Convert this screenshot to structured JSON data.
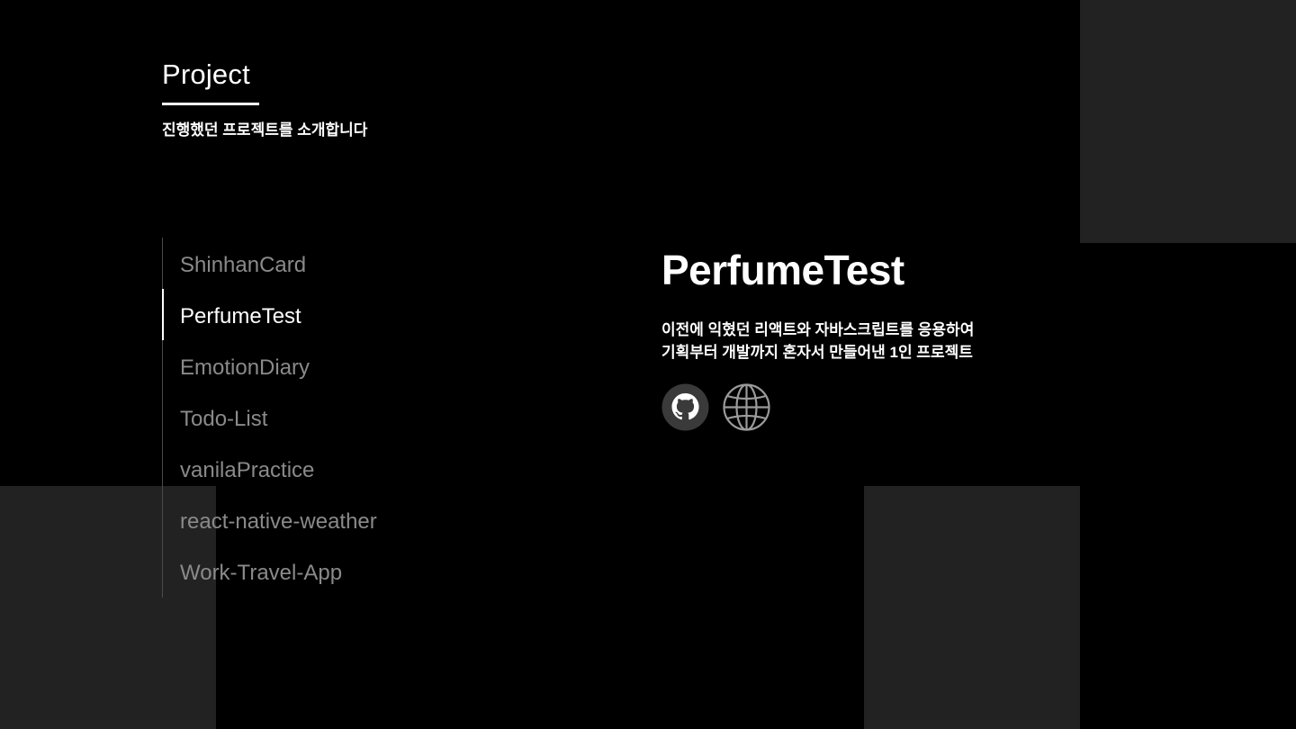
{
  "section": {
    "title": "Project",
    "subtitle": "진행했던 프로젝트를 소개합니다"
  },
  "projects": [
    {
      "label": "ShinhanCard",
      "active": false
    },
    {
      "label": "PerfumeTest",
      "active": true
    },
    {
      "label": "EmotionDiary",
      "active": false
    },
    {
      "label": "Todo-List",
      "active": false
    },
    {
      "label": "vanilaPractice",
      "active": false
    },
    {
      "label": "react-native-weather",
      "active": false
    },
    {
      "label": "Work-Travel-App",
      "active": false
    }
  ],
  "detail": {
    "title": "PerfumeTest",
    "description_line1": "이전에 익혔던 리액트와 자바스크립트를 응용하여",
    "description_line2": "기획부터 개발까지 혼자서 만들어낸 1인 프로젝트",
    "links": [
      {
        "icon": "github-icon"
      },
      {
        "icon": "globe-icon"
      }
    ]
  },
  "colors": {
    "background": "#000000",
    "block": "#222222",
    "text": "#ffffff",
    "muted_text": "#8a8a8a",
    "divider": "#4a4a4a"
  }
}
